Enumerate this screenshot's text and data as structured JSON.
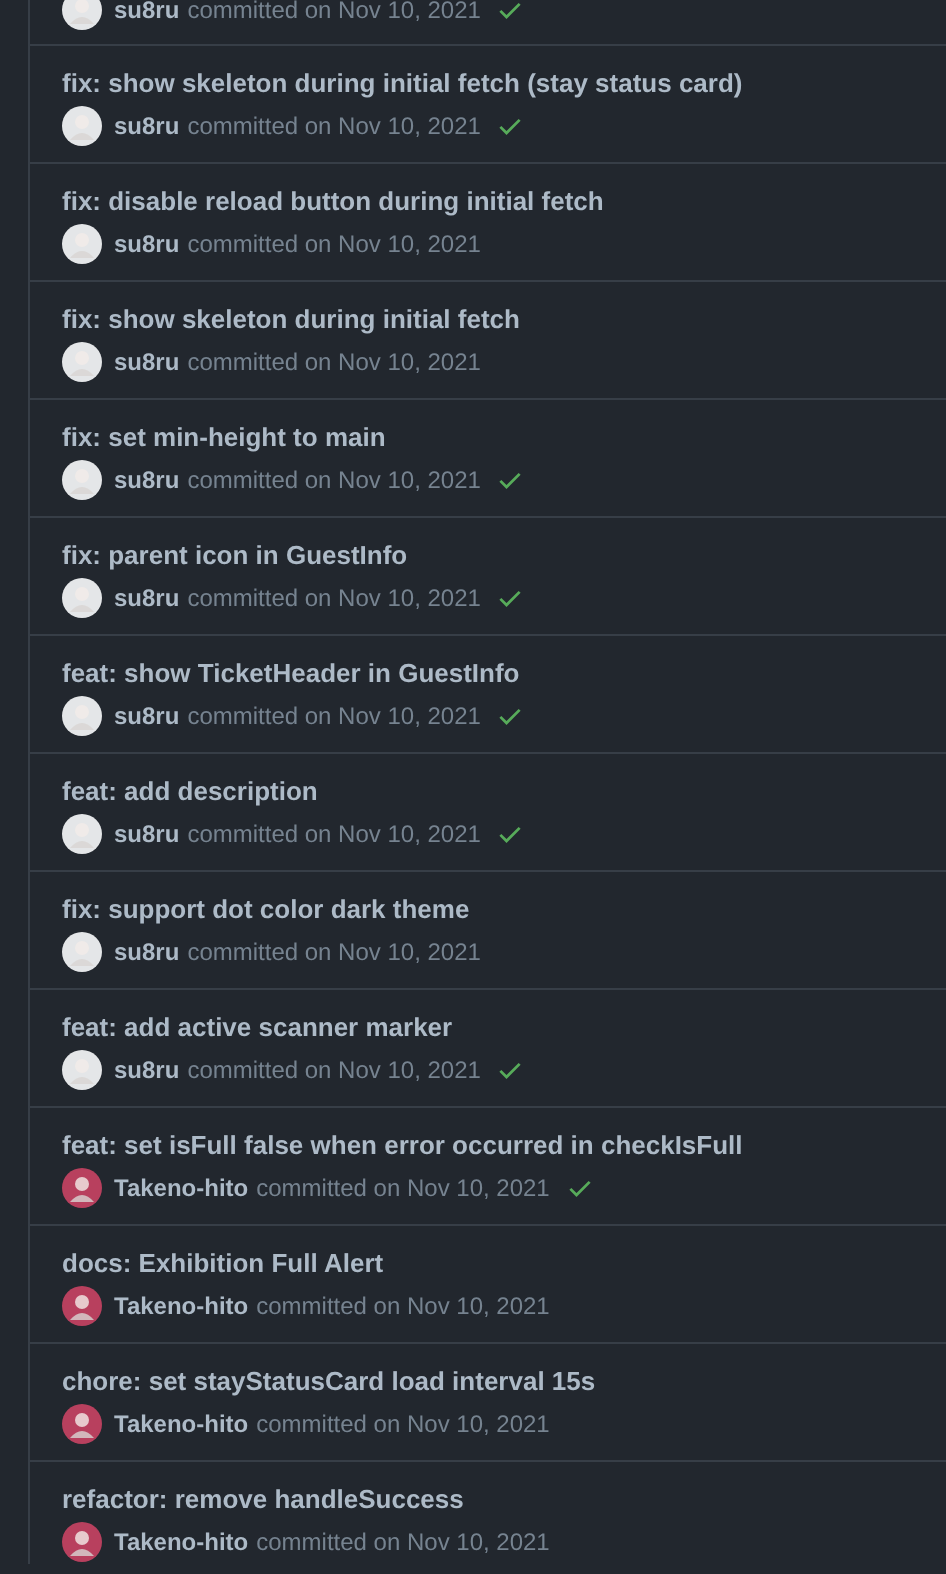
{
  "commits": [
    {
      "author": "su8ru",
      "meta": "committed on Nov 10, 2021",
      "verified": true,
      "color": "#e4e6e8"
    },
    {
      "title": "fix: show skeleton during initial fetch (stay status card)",
      "author": "su8ru",
      "meta": "committed on Nov 10, 2021",
      "verified": true,
      "color": "#e4e6e8"
    },
    {
      "title": "fix: disable reload button during initial fetch",
      "author": "su8ru",
      "meta": "committed on Nov 10, 2021",
      "verified": false,
      "color": "#e4e6e8"
    },
    {
      "title": "fix: show skeleton during initial fetch",
      "author": "su8ru",
      "meta": "committed on Nov 10, 2021",
      "verified": false,
      "color": "#e4e6e8"
    },
    {
      "title": "fix: set min-height to main",
      "author": "su8ru",
      "meta": "committed on Nov 10, 2021",
      "verified": true,
      "color": "#e4e6e8"
    },
    {
      "title": "fix: parent icon in GuestInfo",
      "author": "su8ru",
      "meta": "committed on Nov 10, 2021",
      "verified": true,
      "color": "#e4e6e8"
    },
    {
      "title": "feat: show TicketHeader in GuestInfo",
      "author": "su8ru",
      "meta": "committed on Nov 10, 2021",
      "verified": true,
      "color": "#e4e6e8"
    },
    {
      "title": "feat: add description",
      "author": "su8ru",
      "meta": "committed on Nov 10, 2021",
      "verified": true,
      "color": "#e4e6e8"
    },
    {
      "title": "fix: support dot color dark theme",
      "author": "su8ru",
      "meta": "committed on Nov 10, 2021",
      "verified": false,
      "color": "#e4e6e8"
    },
    {
      "title": "feat: add active scanner marker",
      "author": "su8ru",
      "meta": "committed on Nov 10, 2021",
      "verified": true,
      "color": "#e4e6e8"
    },
    {
      "title": "feat: set isFull false when error occurred in checkIsFull",
      "author": "Takeno-hito",
      "meta": "committed on Nov 10, 2021",
      "verified": true,
      "color": "#b8405e"
    },
    {
      "title": "docs: Exhibition Full Alert",
      "author": "Takeno-hito",
      "meta": "committed on Nov 10, 2021",
      "verified": false,
      "color": "#b8405e"
    },
    {
      "title": "chore: set stayStatusCard load interval 15s",
      "author": "Takeno-hito",
      "meta": "committed on Nov 10, 2021",
      "verified": false,
      "color": "#b8405e"
    },
    {
      "title": "refactor: remove handleSuccess",
      "author": "Takeno-hito",
      "meta": "committed on Nov 10, 2021",
      "verified": false,
      "color": "#b8405e"
    }
  ]
}
